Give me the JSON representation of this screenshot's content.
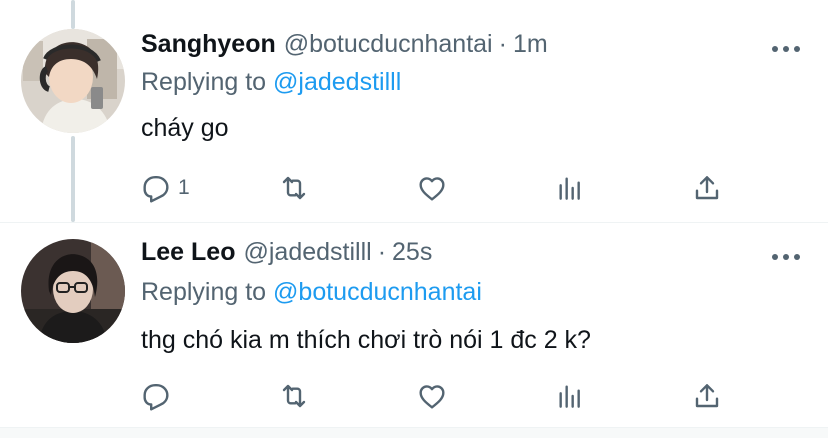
{
  "tweets": [
    {
      "name": "Sanghyeon",
      "handle": "@botucducnhantai",
      "dot": "·",
      "time": "1m",
      "replying_prefix": "Replying to",
      "replying_to": "@jadedstilll",
      "text": "cháy go",
      "reply_count": "1",
      "avatar_icon": "profile-photo-person-with-headphones"
    },
    {
      "name": "Lee Leo",
      "handle": "@jadedstilll",
      "dot": "·",
      "time": "25s",
      "replying_prefix": "Replying to",
      "replying_to": "@botucducnhantai",
      "text": "thg chó kia m thích chơi trò nói 1 đc 2 k?",
      "reply_count": "",
      "avatar_icon": "profile-photo-person-with-glasses"
    }
  ],
  "colors": {
    "link": "#1d9bf0",
    "secondary_text": "#536471",
    "primary_text": "#0f1419",
    "thread_line": "#cfd9de"
  }
}
